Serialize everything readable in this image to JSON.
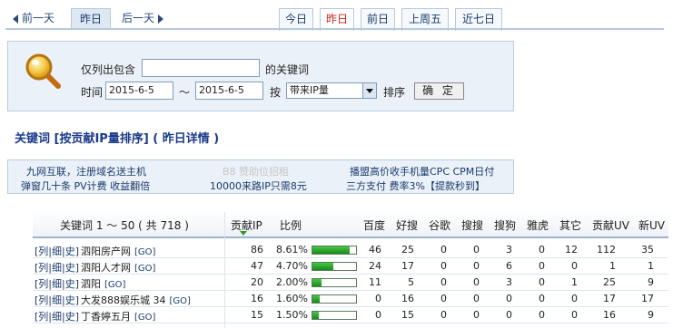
{
  "nav": {
    "prev_label": "前一天",
    "current_label": "昨日",
    "next_label": "后一天",
    "right_tabs": [
      "今日",
      "昨日",
      "前日",
      "上周五",
      "近七日"
    ],
    "active_right_tab": "昨日"
  },
  "search": {
    "filter_label": "仅列出包含",
    "keyword_value": "",
    "keyword_suffix": "的关键词",
    "time_label": "时间",
    "date_from": "2015-6-5",
    "range_sep": "～",
    "date_to": "2015-6-5",
    "by_label": "按",
    "sort_option": "带来IP量",
    "sort_label": "排序",
    "confirm_label": "确 定"
  },
  "heading": "关键词 [按贡献IP量排序] ( 昨日详情 )",
  "ads": [
    "九网互联，注册域名送主机",
    "弹窗几十条 PV计费 收益翻倍",
    "B8 赞助位招租",
    "10000来路IP只需8元",
    "播盟高价收手机量CPC CPM日付",
    "三方支付 费率3%【提款秒到】"
  ],
  "table": {
    "title": "关键词 1 ～ 50 ( 共 718 )",
    "headers": [
      "贡献IP",
      "比例",
      "百度",
      "好搜",
      "谷歌",
      "搜搜",
      "搜狗",
      "雅虎",
      "其它",
      "贡献UV",
      "新UV"
    ],
    "link_text": "[列|细|史]",
    "go_text": "[GO]",
    "rows": [
      {
        "keyword": "泗阳房产网",
        "ip": "86",
        "ratio": "8.61%",
        "ratio_value": 8.61,
        "baidu": "46",
        "haosou": "25",
        "google": "0",
        "soso": "0",
        "sogou": "3",
        "yahoo": "0",
        "other": "12",
        "uv": "112",
        "new_uv": "35"
      },
      {
        "keyword": "泗阳人才网",
        "ip": "47",
        "ratio": "4.70%",
        "ratio_value": 4.7,
        "baidu": "24",
        "haosou": "17",
        "google": "0",
        "soso": "0",
        "sogou": "6",
        "yahoo": "0",
        "other": "0",
        "uv": "1",
        "new_uv": "1"
      },
      {
        "keyword": "泗阳",
        "ip": "20",
        "ratio": "2.00%",
        "ratio_value": 2.0,
        "baidu": "11",
        "haosou": "5",
        "google": "0",
        "soso": "0",
        "sogou": "3",
        "yahoo": "0",
        "other": "1",
        "uv": "25",
        "new_uv": "9"
      },
      {
        "keyword": "大发888娱乐城 34",
        "ip": "16",
        "ratio": "1.60%",
        "ratio_value": 1.6,
        "baidu": "0",
        "haosou": "16",
        "google": "0",
        "soso": "0",
        "sogou": "0",
        "yahoo": "0",
        "other": "0",
        "uv": "17",
        "new_uv": "17"
      },
      {
        "keyword": "丁香婷五月",
        "ip": "15",
        "ratio": "1.50%",
        "ratio_value": 1.5,
        "baidu": "0",
        "haosou": "15",
        "google": "0",
        "soso": "0",
        "sogou": "0",
        "yahoo": "0",
        "other": "0",
        "uv": "16",
        "new_uv": "9"
      }
    ]
  }
}
